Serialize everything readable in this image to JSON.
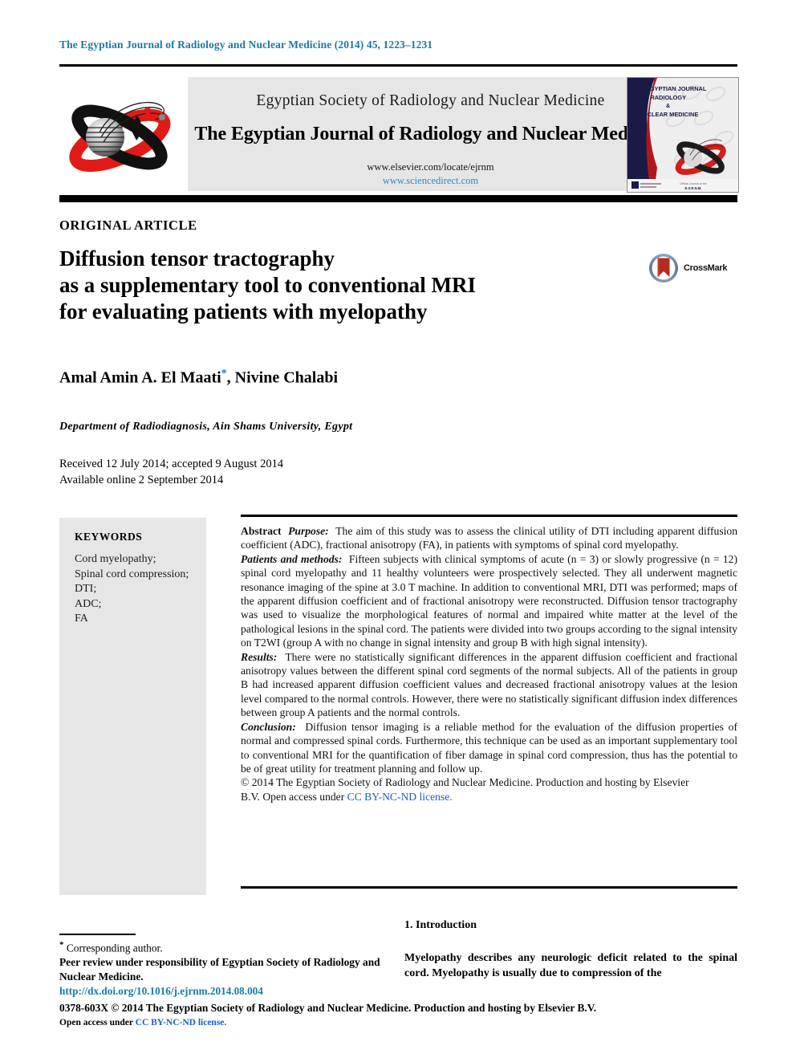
{
  "running_head": "The Egyptian Journal of Radiology and Nuclear Medicine (2014) 45, 1223–1231",
  "masthead": {
    "society": "Egyptian Society of Radiology and Nuclear Medicine",
    "journal": "The Egyptian Journal of Radiology and Nuclear Medicine",
    "url_elsevier": "www.elsevier.com/locate/ejrnm",
    "url_sciencedirect": "www.sciencedirect.com",
    "cover": {
      "line1": "THE EGYPTIAN JOURNAL",
      "line2": "OF RADIOLOGY",
      "line3": "&",
      "line4": "NUCLEAR MEDICINE",
      "footer_left": "",
      "footer_right": "Official Journal of the E.S.R.N.M."
    }
  },
  "article_type": "ORIGINAL ARTICLE",
  "title": {
    "line1": "Diffusion tensor tractography",
    "line2": "as a supplementary tool to conventional MRI",
    "line3": "for evaluating patients with myelopathy"
  },
  "crossmark": {
    "label": "CrossMark"
  },
  "authors": {
    "name1": "Amal Amin A. El Maati",
    "corresponding_marker": "*",
    "name2": ", Nivine Chalabi"
  },
  "affiliation": "Department of Radiodiagnosis, Ain Shams University, Egypt",
  "dates": {
    "received": "Received 12 July 2014; accepted 9 August 2014",
    "available": "Available online 2 September 2014"
  },
  "keywords": {
    "heading": "KEYWORDS",
    "items": [
      "Cord myelopathy;",
      "Spinal cord compression;",
      "DTI;",
      "ADC;",
      "FA"
    ]
  },
  "abstract": {
    "label": "Abstract",
    "purpose_label": "Purpose:",
    "purpose_text": "The aim of this study was to assess the clinical utility of DTI including apparent diffusion coefficient (ADC), fractional anisotropy (FA), in patients with symptoms of spinal cord myelopathy.",
    "methods_label": "Patients and methods:",
    "methods_text": "Fifteen subjects with clinical symptoms of acute (n = 3) or slowly progressive (n = 12) spinal cord myelopathy and 11 healthy volunteers were prospectively selected. They all underwent magnetic resonance imaging of the spine at 3.0 T machine. In addition to conventional MRI, DTI was performed; maps of the apparent diffusion coefficient and of fractional anisotropy were reconstructed. Diffusion tensor tractography was used to visualize the morphological features of normal and impaired white matter at the level of the pathological lesions in the spinal cord. The patients were divided into two groups according to the signal intensity on T2WI (group A with no change in signal intensity and group B with high signal intensity).",
    "results_label": "Results:",
    "results_text": "There were no statistically significant differences in the apparent diffusion coefficient and fractional anisotropy values between the different spinal cord segments of the normal subjects. All of the patients in group B had increased apparent diffusion coefficient values and decreased fractional anisotropy values at the lesion level compared to the normal controls. However, there were no statistically significant diffusion index differences between group A patients and the normal controls.",
    "conclusion_label": "Conclusion:",
    "conclusion_text": "Diffusion tensor imaging is a reliable method for the evaluation of the diffusion properties of normal and compressed spinal cords. Furthermore, this technique can be used as an important supplementary tool to conventional MRI for the quantification of fiber damage in spinal cord compression, thus has the potential to be of great utility for treatment planning and follow up.",
    "copyright_line": "© 2014 The Egyptian Society of Radiology and Nuclear Medicine. Production and hosting by Elsevier",
    "copyright_line2": "B.V. Open access under",
    "copyright_license": "CC BY-NC-ND license."
  },
  "footnote": {
    "corresponding_marker": "*",
    "corresponding": "Corresponding author.",
    "peer_review": "Peer review under responsibility of Egyptian Society of Radiology and Nuclear Medicine.",
    "doi": "http://dx.doi.org/10.1016/j.ejrnm.2014.08.004",
    "issn": "0378-603X © 2014 The Egyptian Society of Radiology and Nuclear Medicine. Production and hosting by Elsevier B.V.",
    "open_access_prefix": "Open access under",
    "open_access_license": "CC BY-NC-ND license."
  },
  "introduction": {
    "heading": "1. Introduction",
    "paragraph": "Myelopathy describes any neurologic deficit related to the spinal cord. Myelopathy is usually due to compression of the"
  },
  "colors": {
    "running_head": "#1a7aa8",
    "link_blue": "#1a5fc4",
    "sciencedirect_blue": "#2e8bc0",
    "panel_gray": "#e6e6e6",
    "logo_red": "#e01b17",
    "logo_black": "#111111"
  }
}
